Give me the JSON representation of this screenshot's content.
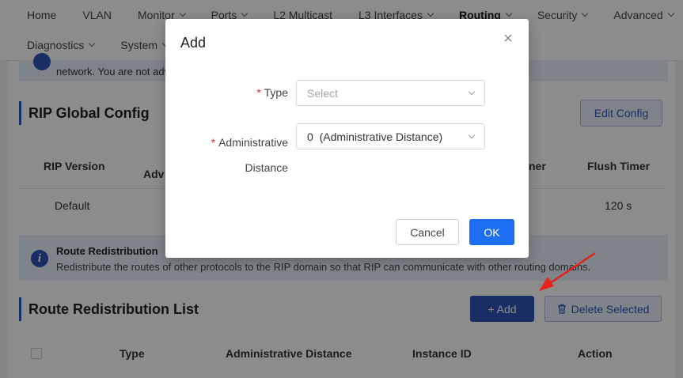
{
  "nav": {
    "row1": [
      {
        "label": "Home",
        "dropdown": false
      },
      {
        "label": "VLAN",
        "dropdown": false
      },
      {
        "label": "Monitor",
        "dropdown": true
      },
      {
        "label": "Ports",
        "dropdown": true
      },
      {
        "label": "L2 Multicast",
        "dropdown": false
      },
      {
        "label": "L3 Interfaces",
        "dropdown": true
      },
      {
        "label": "Routing",
        "dropdown": true,
        "active": true
      },
      {
        "label": "Security",
        "dropdown": true
      },
      {
        "label": "Advanced",
        "dropdown": true
      }
    ],
    "row2": [
      {
        "label": "Diagnostics",
        "dropdown": true
      },
      {
        "label": "System",
        "dropdown": true
      }
    ]
  },
  "notice": {
    "text": "network. You are not adv"
  },
  "rip_global": {
    "title": "RIP Global Config",
    "edit_button": "Edit Config",
    "columns": {
      "rip_version": "RIP Version",
      "adv": "Adv",
      "timer_partial": "ner",
      "flush_timer": "Flush Timer"
    },
    "row": {
      "rip_version": "Default",
      "flush_timer": "120 s"
    }
  },
  "redistribution_info": {
    "title": "Route Redistribution",
    "description": "Redistribute the routes of other protocols to the RIP domain so that RIP can communicate with other routing domains."
  },
  "redistribution_list": {
    "title": "Route Redistribution List",
    "add_button": "+ Add",
    "delete_button": "Delete Selected",
    "columns": {
      "type": "Type",
      "distance": "Administrative Distance",
      "instance": "Instance ID",
      "action": "Action"
    }
  },
  "modal": {
    "title": "Add",
    "close": "×",
    "type_label": "Type",
    "type_placeholder": "Select",
    "distance_label_line1": "Administrative",
    "distance_label_line2": "Distance",
    "distance_value": "0  (Administrative Distance)",
    "required_mark": "*",
    "cancel": "Cancel",
    "ok": "OK"
  },
  "colors": {
    "primary": "#2f55b8",
    "ok_button": "#1d6ff2",
    "annotation_arrow": "#e8221b"
  }
}
